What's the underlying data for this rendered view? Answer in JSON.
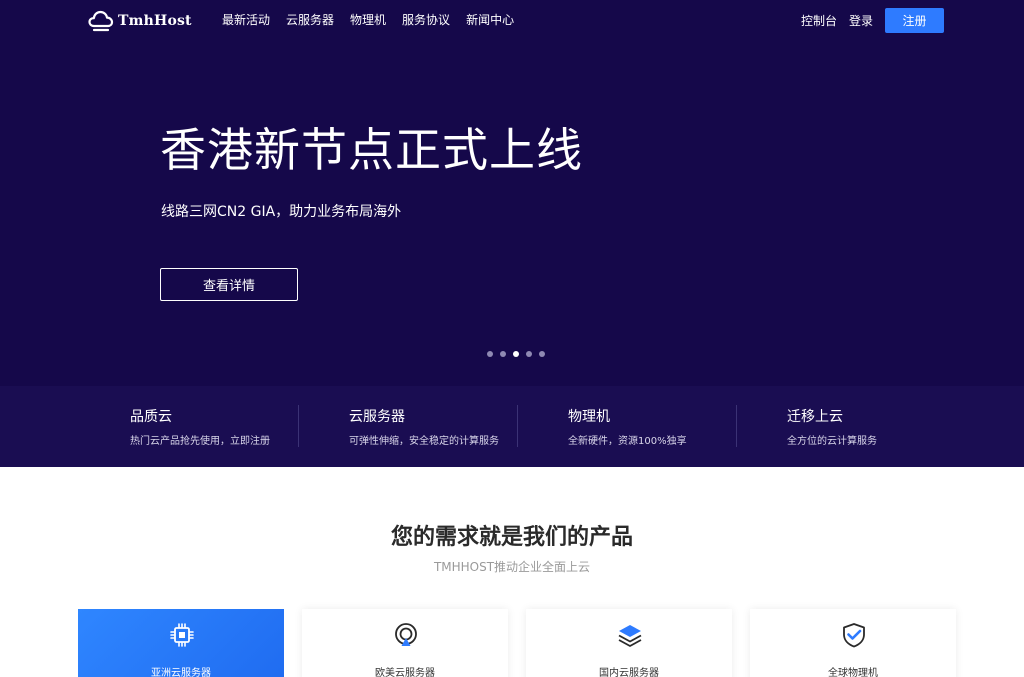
{
  "brand": {
    "name": "TmhHost"
  },
  "nav": {
    "items": [
      "最新活动",
      "云服务器",
      "物理机",
      "服务协议",
      "新闻中心"
    ],
    "console": "控制台",
    "login": "登录",
    "register": "注册"
  },
  "hero": {
    "title": "香港新节点正式上线",
    "subtitle": "线路三网CN2 GIA，助力业务布局海外",
    "button": "查看详情",
    "slides_total": 5,
    "active_slide": 3
  },
  "features": [
    {
      "title": "品质云",
      "desc": "热门云产品抢先使用，立即注册"
    },
    {
      "title": "云服务器",
      "desc": "可弹性伸缩，安全稳定的计算服务"
    },
    {
      "title": "物理机",
      "desc": "全新硬件，资源100%独享"
    },
    {
      "title": "迁移上云",
      "desc": "全方位的云计算服务"
    }
  ],
  "products": {
    "title": "您的需求就是我们的产品",
    "subtitle": "TMHHOST推动企业全面上云",
    "cards": [
      {
        "label": "亚洲云服务器",
        "icon": "chip-icon"
      },
      {
        "label": "欧美云服务器",
        "icon": "location-ring-icon"
      },
      {
        "label": "国内云服务器",
        "icon": "layers-icon"
      },
      {
        "label": "全球物理机",
        "icon": "shield-check-icon"
      }
    ]
  },
  "colors": {
    "hero_bg": "#15084a",
    "feature_bar_bg": "#1a0d52",
    "accent_blue": "#2e7bff"
  }
}
